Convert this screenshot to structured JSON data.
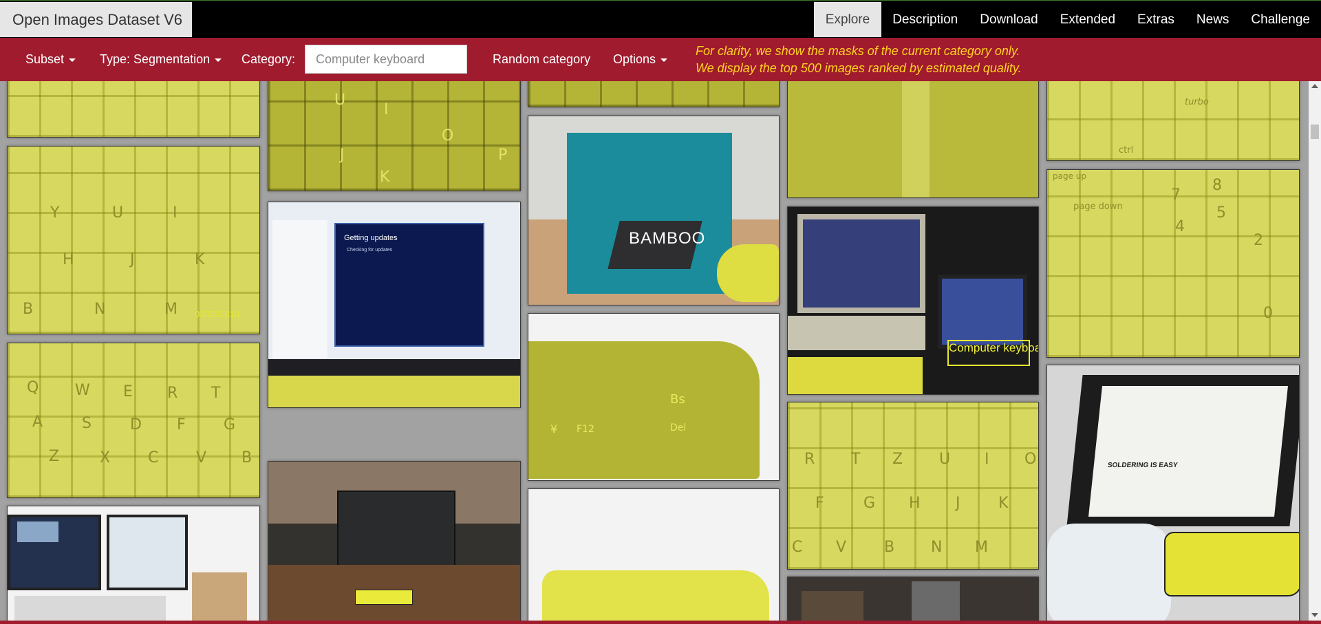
{
  "brand": {
    "title": "Open Images Dataset V6"
  },
  "nav": {
    "items": [
      "Explore",
      "Description",
      "Download",
      "Extended",
      "Extras",
      "News",
      "Challenge"
    ],
    "active": "Explore"
  },
  "toolbar": {
    "subset_label": "Subset",
    "type_label": "Type: Segmentation",
    "category_label": "Category:",
    "category_placeholder": "Computer keyboard",
    "random_label": "Random category",
    "options_label": "Options",
    "notice_line1": "For clarity, we show the masks of the current category only.",
    "notice_line2": "We display the top 500 images ranked by estimated quality."
  },
  "gallery": {
    "date_stamp": "03/02/2010",
    "box_label": "Computer keyboard",
    "screen_title": "Getting updates",
    "screen_subtitle": "Checking for updates",
    "box_brand": "BAMBOO",
    "book_heading": "SOLDERING IS EASY",
    "keys_a": [
      "U",
      "I",
      "O",
      "P",
      "J",
      "K"
    ],
    "keys_b": [
      "Y",
      "U",
      "I",
      "H",
      "J",
      "K",
      "B",
      "N",
      "M"
    ],
    "keys_c": [
      "Q",
      "W",
      "E",
      "R",
      "T",
      "A",
      "S",
      "D",
      "F",
      "G",
      "Z",
      "X",
      "C",
      "V",
      "B"
    ],
    "keys_d": [
      "R",
      "T",
      "Z",
      "U",
      "I",
      "O",
      "F",
      "G",
      "H",
      "J",
      "K",
      "C",
      "V",
      "B",
      "N",
      "M"
    ],
    "keys_e": [
      "Bs",
      "Del",
      "F12",
      "¥"
    ],
    "keys_f": [
      "turbo",
      "ctrl",
      "page up",
      "page down",
      "7",
      "8",
      "5",
      "4",
      "2",
      "0"
    ]
  },
  "colors": {
    "mask": "#dede4e",
    "toolbar": "#a01b2e",
    "notice": "#ffd21f"
  }
}
